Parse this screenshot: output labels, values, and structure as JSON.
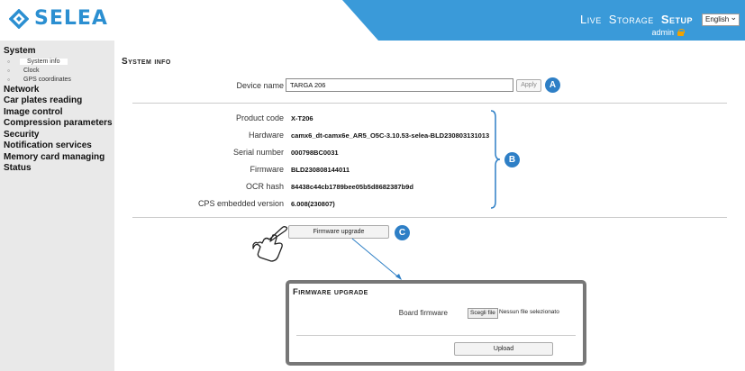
{
  "header": {
    "logo_text": "SELEA",
    "nav": [
      "Live",
      "Storage",
      "Setup"
    ],
    "active_nav": "Setup",
    "user": "admin",
    "language": "English",
    "accent_color": "#3a9ad9"
  },
  "sidebar": {
    "items": [
      {
        "label": "System",
        "subitems": [
          "System info",
          "Clock",
          "GPS coordinates"
        ]
      },
      {
        "label": "Network"
      },
      {
        "label": "Car plates reading"
      },
      {
        "label": "Image control"
      },
      {
        "label": "Compression parameters"
      },
      {
        "label": "Security"
      },
      {
        "label": "Notification services"
      },
      {
        "label": "Memory card managing"
      },
      {
        "label": "Status"
      }
    ],
    "selected_sub": "System info"
  },
  "main": {
    "title": "System info",
    "device_name_label": "Device name",
    "device_name_value": "TARGA 206",
    "apply_label": "Apply",
    "info": [
      {
        "label": "Product code",
        "value": "X-T206"
      },
      {
        "label": "Hardware",
        "value": "camx6_dt-camx6e_AR5_O5C-3.10.53-selea-BLD230803131013"
      },
      {
        "label": "Serial number",
        "value": "000798BC0031"
      },
      {
        "label": "Firmware",
        "value": "BLD230808144011"
      },
      {
        "label": "OCR hash",
        "value": "84438c44cb1789bee05b5d8682387b9d"
      },
      {
        "label": "CPS embedded version",
        "value": "6.008(230807)"
      }
    ],
    "firmware_button": "Firmware upgrade",
    "badges": [
      "A",
      "B",
      "C"
    ]
  },
  "popup": {
    "title": "Firmware upgrade",
    "board_label": "Board firmware",
    "file_button": "Scegli file",
    "file_status": "Nessun file selezionato",
    "upload_label": "Upload"
  }
}
